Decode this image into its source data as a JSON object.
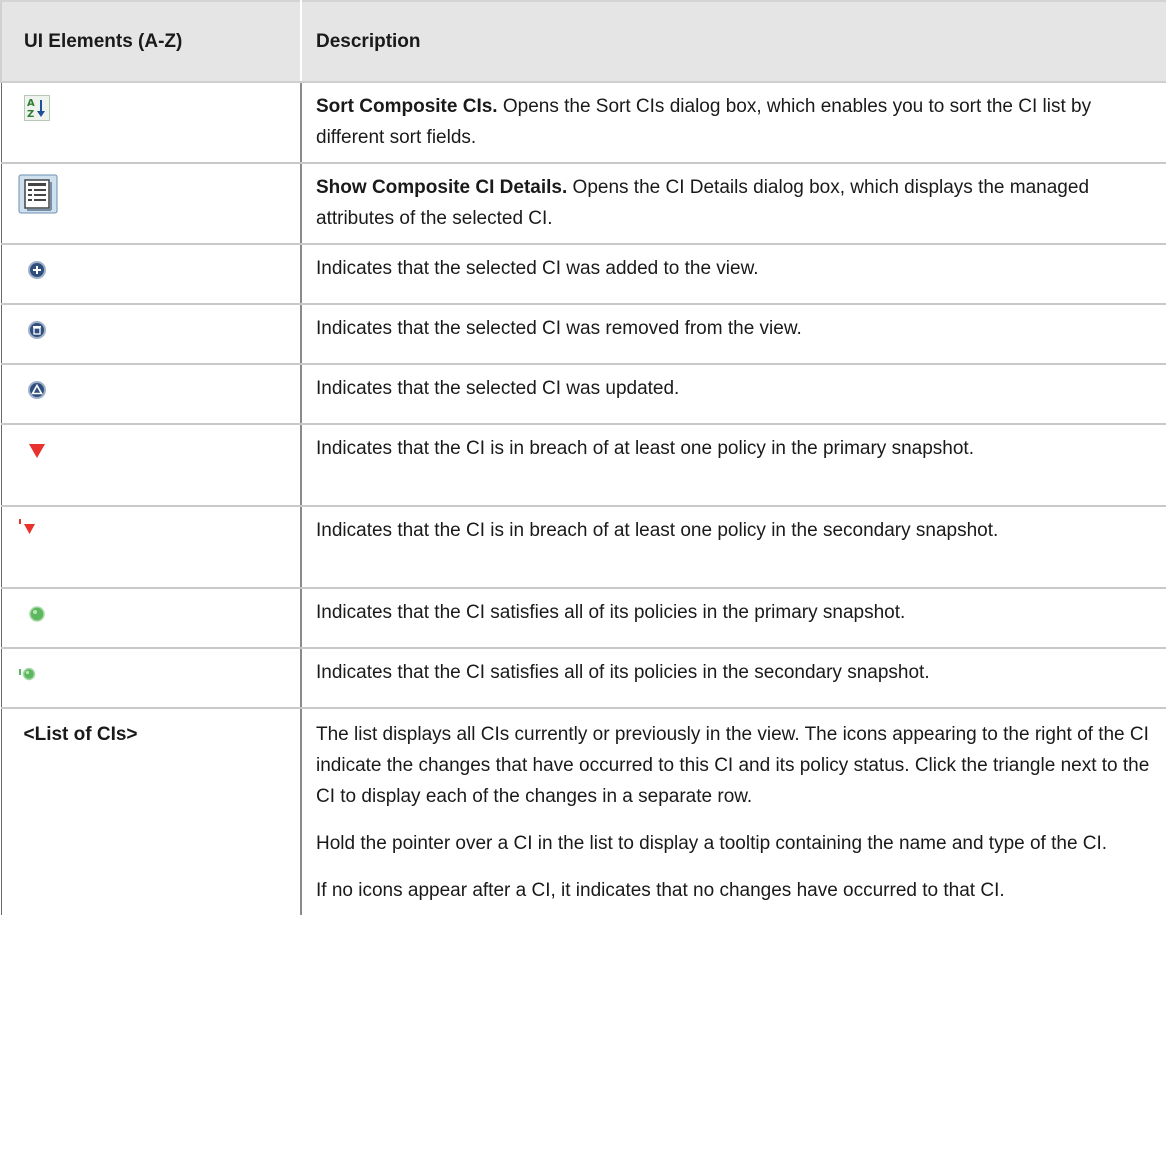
{
  "table": {
    "headers": [
      "UI Elements (A-Z)",
      "Description"
    ],
    "rows": [
      {
        "element_icon": "sort-az-icon",
        "term": "Sort Composite CIs.",
        "text": " Opens the Sort CIs dialog box, which enables you to sort the CI list by different sort fields."
      },
      {
        "element_icon": "details-icon",
        "term": "Show Composite CI Details.",
        "text": " Opens the CI Details dialog box, which displays the managed attributes of the selected CI."
      },
      {
        "element_icon": "added-icon",
        "text": "Indicates that the selected CI was added to the view."
      },
      {
        "element_icon": "removed-icon",
        "text": "Indicates that the selected CI was removed from the view."
      },
      {
        "element_icon": "updated-icon",
        "text": "Indicates that the selected CI was updated."
      },
      {
        "element_icon": "breach-primary-icon",
        "text": "Indicates that the CI is in breach of at least one policy in the primary snapshot."
      },
      {
        "element_icon": "breach-secondary-icon",
        "text": "Indicates that the CI is in breach of at least one policy in the secondary snapshot."
      },
      {
        "element_icon": "satisfies-primary-icon",
        "text": "Indicates that the CI satisfies all of its policies in the primary snapshot."
      },
      {
        "element_icon": "satisfies-secondary-icon",
        "text": "Indicates that the CI satisfies all of its policies in the secondary snapshot."
      },
      {
        "element_label": "<List of CIs>",
        "paragraphs": [
          "The list displays all CIs currently or previously in the view. The icons appearing to the right of the CI indicate the changes that have occurred to this CI and its policy status. Click the triangle next to the CI to display each of the changes in a separate row.",
          "Hold the pointer over a CI in the list to display a tooltip containing the name and type of the CI.",
          "If no icons appear after a CI, it indicates that no changes have occurred to that CI."
        ]
      }
    ]
  },
  "colors": {
    "header_bg": "#e5e5e5",
    "breach": "#e8322d",
    "ok": "#5cb85c",
    "status_blue": "#2f4f7f"
  }
}
